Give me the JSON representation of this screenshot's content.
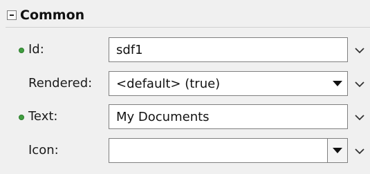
{
  "section": {
    "title": "Common",
    "collapse_icon": "collapse-minus-icon"
  },
  "fields": {
    "id": {
      "label": "Id:",
      "value": "sdf1",
      "required": true
    },
    "rendered": {
      "label": "Rendered:",
      "value": "<default> (true)"
    },
    "text": {
      "label": "Text:",
      "value": "My Documents",
      "required": true
    },
    "icon": {
      "label": "Icon:",
      "value": ""
    }
  },
  "colors": {
    "required_bullet": "#3f9e3f",
    "field_border": "#7f7f7f",
    "panel_background": "#f0f0f0"
  }
}
